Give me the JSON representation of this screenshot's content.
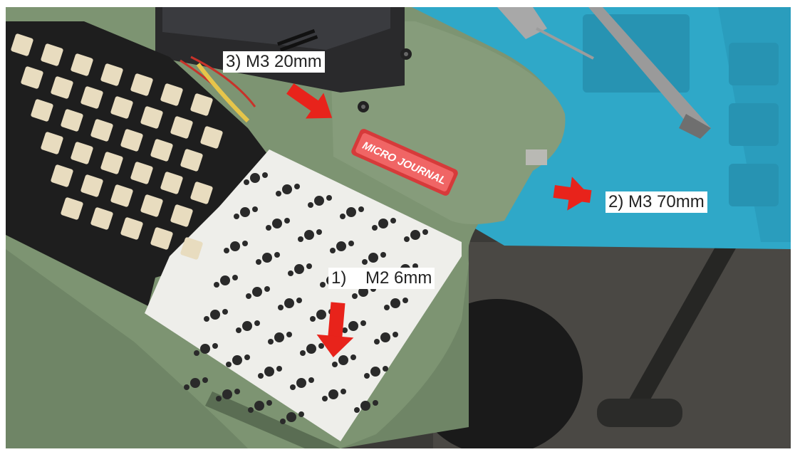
{
  "annotations": {
    "label_1": "1)    M2 6mm",
    "label_2": "2) M3 70mm",
    "label_3": "3) M3 20mm"
  },
  "device": {
    "badge_text": "MICRO JOURNAL"
  },
  "colors": {
    "arrow": "#e8231b",
    "case_green": "#7d9472",
    "mat_blue": "#2fa8c8",
    "pcb_white": "#eeeeea",
    "plate_black": "#1e1e1e",
    "badge_red": "#e64a4a"
  }
}
